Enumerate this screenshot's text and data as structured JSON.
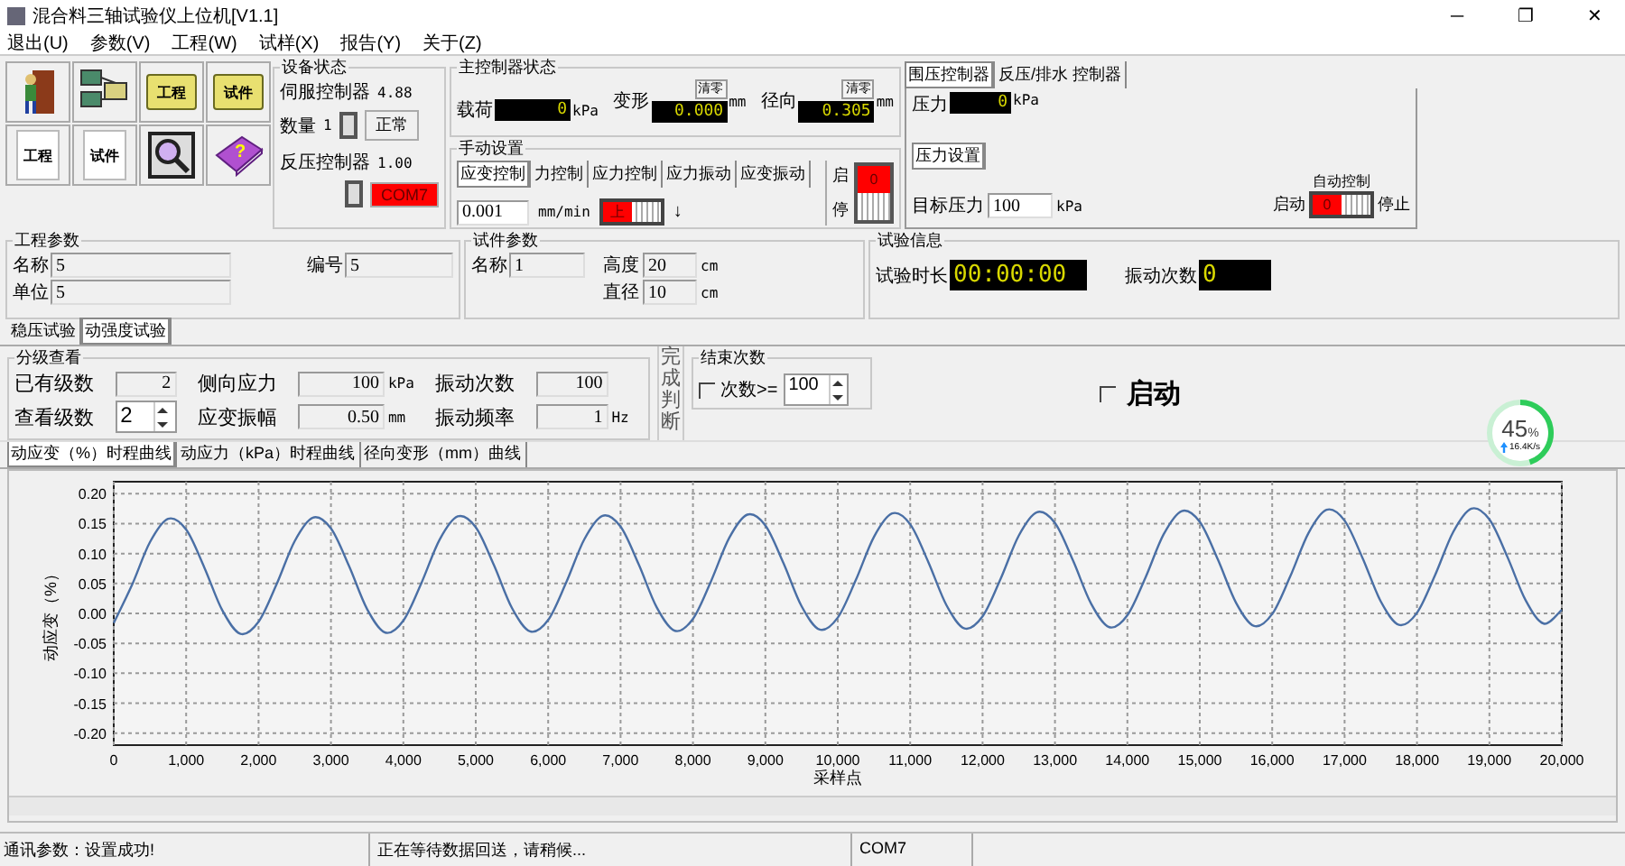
{
  "window": {
    "title": "混合料三轴试验仪上位机[V1.1]",
    "controls": [
      "─",
      "❐",
      "✕"
    ]
  },
  "menu": [
    "退出(U)",
    "参数(V)",
    "工程(W)",
    "试样(X)",
    "报告(Y)",
    "关于(Z)"
  ],
  "toolbar": [
    {
      "kind": "exit"
    },
    {
      "kind": "network"
    },
    {
      "kind": "folder",
      "label": "工程"
    },
    {
      "kind": "folder",
      "label": "试件"
    },
    {
      "kind": "page",
      "label": "工程"
    },
    {
      "kind": "page",
      "label": "试件"
    },
    {
      "kind": "search"
    },
    {
      "kind": "help",
      "label": "?"
    }
  ],
  "device_status": {
    "title": "设备状态",
    "servo": {
      "label": "伺服控制器",
      "value": "4.88"
    },
    "count": {
      "label": "数量",
      "value": "1"
    },
    "servo_state": "正常",
    "back": {
      "label": "反压控制器",
      "value": "1.00"
    },
    "back_port": "COM7"
  },
  "main_controller": {
    "title": "主控制器状态",
    "readings": [
      {
        "label": "载荷",
        "value": "0",
        "unit": "kPa"
      },
      {
        "label": "变形",
        "value": "0.000",
        "unit": "mm",
        "clear": "清零"
      },
      {
        "label": "径向",
        "value": "0.305",
        "unit": "mm",
        "clear": "清零"
      }
    ]
  },
  "manual": {
    "title": "手动设置",
    "tabs": [
      {
        "label": "应变控制",
        "selected": true
      },
      {
        "label": "力控制",
        "selected": false
      },
      {
        "label": "应力控制",
        "selected": false
      },
      {
        "label": "应力振动",
        "selected": false
      },
      {
        "label": "应变振动",
        "selected": false
      }
    ],
    "rate": {
      "value": "0.001",
      "unit": "mm/min"
    },
    "direction": {
      "label": "上",
      "on": true
    },
    "arrow": "↓",
    "start": "启",
    "stop": "停",
    "run": {
      "value": "0",
      "on": true
    }
  },
  "pressure_panel": {
    "tabs": [
      {
        "label": "围压控制器",
        "selected": true
      },
      {
        "label": "反压/排水 控制器",
        "selected": false
      }
    ],
    "pressure": {
      "label": "压力",
      "value": "0",
      "unit": "kPa"
    },
    "settings_tab": "压力设置",
    "target": {
      "label": "目标压力",
      "value": "100",
      "unit": "kPa"
    },
    "auto": {
      "title": "自动控制",
      "start": "启动",
      "stop": "停止",
      "value": "0",
      "on": true
    }
  },
  "project": {
    "title": "工程参数",
    "name": {
      "label": "名称",
      "value": "5"
    },
    "unit": {
      "label": "单位",
      "value": "5"
    },
    "number": {
      "label": "编号",
      "value": "5"
    }
  },
  "specimen": {
    "title": "试件参数",
    "name": {
      "label": "名称",
      "value": "1"
    },
    "height": {
      "label": "高度",
      "value": "20",
      "unit": "cm"
    },
    "diameter": {
      "label": "直径",
      "value": "10",
      "unit": "cm"
    }
  },
  "test_info": {
    "title": "试验信息",
    "duration": {
      "label": "试验时长",
      "value": "00:00:00"
    },
    "vibrations": {
      "label": "振动次数",
      "value": "0"
    }
  },
  "test_tabs": [
    {
      "label": "稳压试验",
      "selected": false
    },
    {
      "label": "动强度试验",
      "selected": true
    }
  ],
  "level_view": {
    "title": "分级查看",
    "levels": {
      "label": "已有级数",
      "value": "2"
    },
    "lateral": {
      "label": "侧向应力",
      "value": "100",
      "unit": "kPa"
    },
    "vib_count": {
      "label": "振动次数",
      "value": "100"
    },
    "view_level": {
      "label": "查看级数",
      "value": "2"
    },
    "amplitude": {
      "label": "应变振幅",
      "value": "0.50",
      "unit": "mm"
    },
    "frequency": {
      "label": "振动频率",
      "value": "1",
      "unit": "Hz"
    }
  },
  "completion": "完成判断",
  "end_count": {
    "title": "结束次数",
    "label": "次数>=",
    "checked": false,
    "value": "100"
  },
  "start_check": {
    "label": "启动",
    "checked": false
  },
  "speed": {
    "percent": "45",
    "unit": "%",
    "rate": "16.4K/s",
    "level": 0.45
  },
  "chart_tabs": [
    {
      "label": "动应变（%）时程曲线",
      "selected": true
    },
    {
      "label": "动应力（kPa）时程曲线",
      "selected": false
    },
    {
      "label": "径向变形（mm）曲线",
      "selected": false
    }
  ],
  "chart_data": {
    "type": "line",
    "grid": true,
    "xlabel": "采样点",
    "ylabel": "动应变（%）",
    "xlim": [
      0,
      20000
    ],
    "ylim": [
      -0.22,
      0.22
    ],
    "xticks": [
      {
        "value": 0,
        "label": "0"
      },
      {
        "value": 1000,
        "label": "1,000"
      },
      {
        "value": 2000,
        "label": "2,000"
      },
      {
        "value": 3000,
        "label": "3,000"
      },
      {
        "value": 4000,
        "label": "4,000"
      },
      {
        "value": 5000,
        "label": "5,000"
      },
      {
        "value": 6000,
        "label": "6,000"
      },
      {
        "value": 7000,
        "label": "7,000"
      },
      {
        "value": 8000,
        "label": "8,000"
      },
      {
        "value": 9000,
        "label": "9,000"
      },
      {
        "value": 10000,
        "label": "10,000"
      },
      {
        "value": 11000,
        "label": "11,000"
      },
      {
        "value": 12000,
        "label": "12,000"
      },
      {
        "value": 13000,
        "label": "13,000"
      },
      {
        "value": 14000,
        "label": "14,000"
      },
      {
        "value": 15000,
        "label": "15,000"
      },
      {
        "value": 16000,
        "label": "16,000"
      },
      {
        "value": 17000,
        "label": "17,000"
      },
      {
        "value": 18000,
        "label": "18,000"
      },
      {
        "value": 19000,
        "label": "19,000"
      },
      {
        "value": 20000,
        "label": "20,000"
      }
    ],
    "yticks": [
      {
        "value": 0.2,
        "label": "0.20"
      },
      {
        "value": 0.15,
        "label": "0.15"
      },
      {
        "value": 0.1,
        "label": "0.10"
      },
      {
        "value": 0.05,
        "label": "0.05"
      },
      {
        "value": 0,
        "label": "0.00"
      },
      {
        "value": -0.05,
        "label": "-0.05"
      },
      {
        "value": -0.1,
        "label": "-0.10"
      },
      {
        "value": -0.15,
        "label": "-0.15"
      },
      {
        "value": -0.2,
        "label": "-0.20"
      }
    ],
    "x": [
      0,
      250,
      500,
      750,
      1000,
      1250,
      1500,
      1750,
      2000,
      2250,
      2500,
      2750,
      3000,
      3250,
      3500,
      3750,
      4000,
      4250,
      4500,
      4750,
      5000,
      5250,
      5500,
      5750,
      6000,
      6250,
      6500,
      6750,
      7000,
      7250,
      7500,
      7750,
      8000,
      8250,
      8500,
      8750,
      9000,
      9250,
      9500,
      9750,
      10000,
      10250,
      10500,
      10750,
      11000,
      11250,
      11500,
      11750,
      12000,
      12250,
      12500,
      12750,
      13000,
      13250,
      13500,
      13750,
      14000,
      14250,
      14500,
      14750,
      15000,
      15250,
      15500,
      15750,
      16000,
      16250,
      16500,
      16750,
      17000,
      17250,
      17500,
      17750,
      18000,
      18250,
      18500,
      18750,
      19000,
      19250,
      19500,
      19750,
      20000
    ],
    "series": [
      {
        "color": "#4a6fa5",
        "values": [
          -0.016,
          0.047,
          0.119,
          0.158,
          0.14,
          0.077,
          0.005,
          -0.034,
          -0.014,
          0.049,
          0.121,
          0.16,
          0.142,
          0.079,
          0.007,
          -0.032,
          -0.012,
          0.051,
          0.123,
          0.162,
          0.144,
          0.081,
          0.009,
          -0.03,
          -0.011,
          0.052,
          0.124,
          0.163,
          0.145,
          0.082,
          0.01,
          -0.029,
          -0.009,
          0.054,
          0.126,
          0.165,
          0.147,
          0.084,
          0.012,
          -0.027,
          -0.007,
          0.056,
          0.128,
          0.167,
          0.149,
          0.086,
          0.014,
          -0.025,
          -0.005,
          0.058,
          0.13,
          0.169,
          0.151,
          0.088,
          0.016,
          -0.023,
          -0.003,
          0.06,
          0.132,
          0.171,
          0.153,
          0.09,
          0.018,
          -0.021,
          -0.001,
          0.062,
          0.134,
          0.173,
          0.155,
          0.092,
          0.02,
          -0.019,
          0.001,
          0.064,
          0.136,
          0.175,
          0.157,
          0.094,
          0.022,
          -0.017,
          0.006
        ]
      }
    ]
  },
  "status_bar": [
    "通讯参数：设置成功!",
    "正在等待数据回送，请稍候...",
    "COM7"
  ]
}
